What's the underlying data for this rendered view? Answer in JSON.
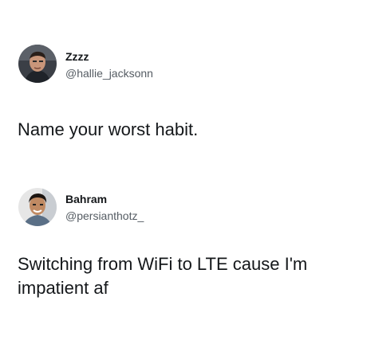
{
  "tweets": [
    {
      "display_name": "Zzzz",
      "handle": "@hallie_jacksonn",
      "text": "Name your worst habit."
    },
    {
      "display_name": "Bahram",
      "handle": "@persianthotz_",
      "text": "Switching from WiFi to LTE cause I'm impatient af"
    }
  ]
}
